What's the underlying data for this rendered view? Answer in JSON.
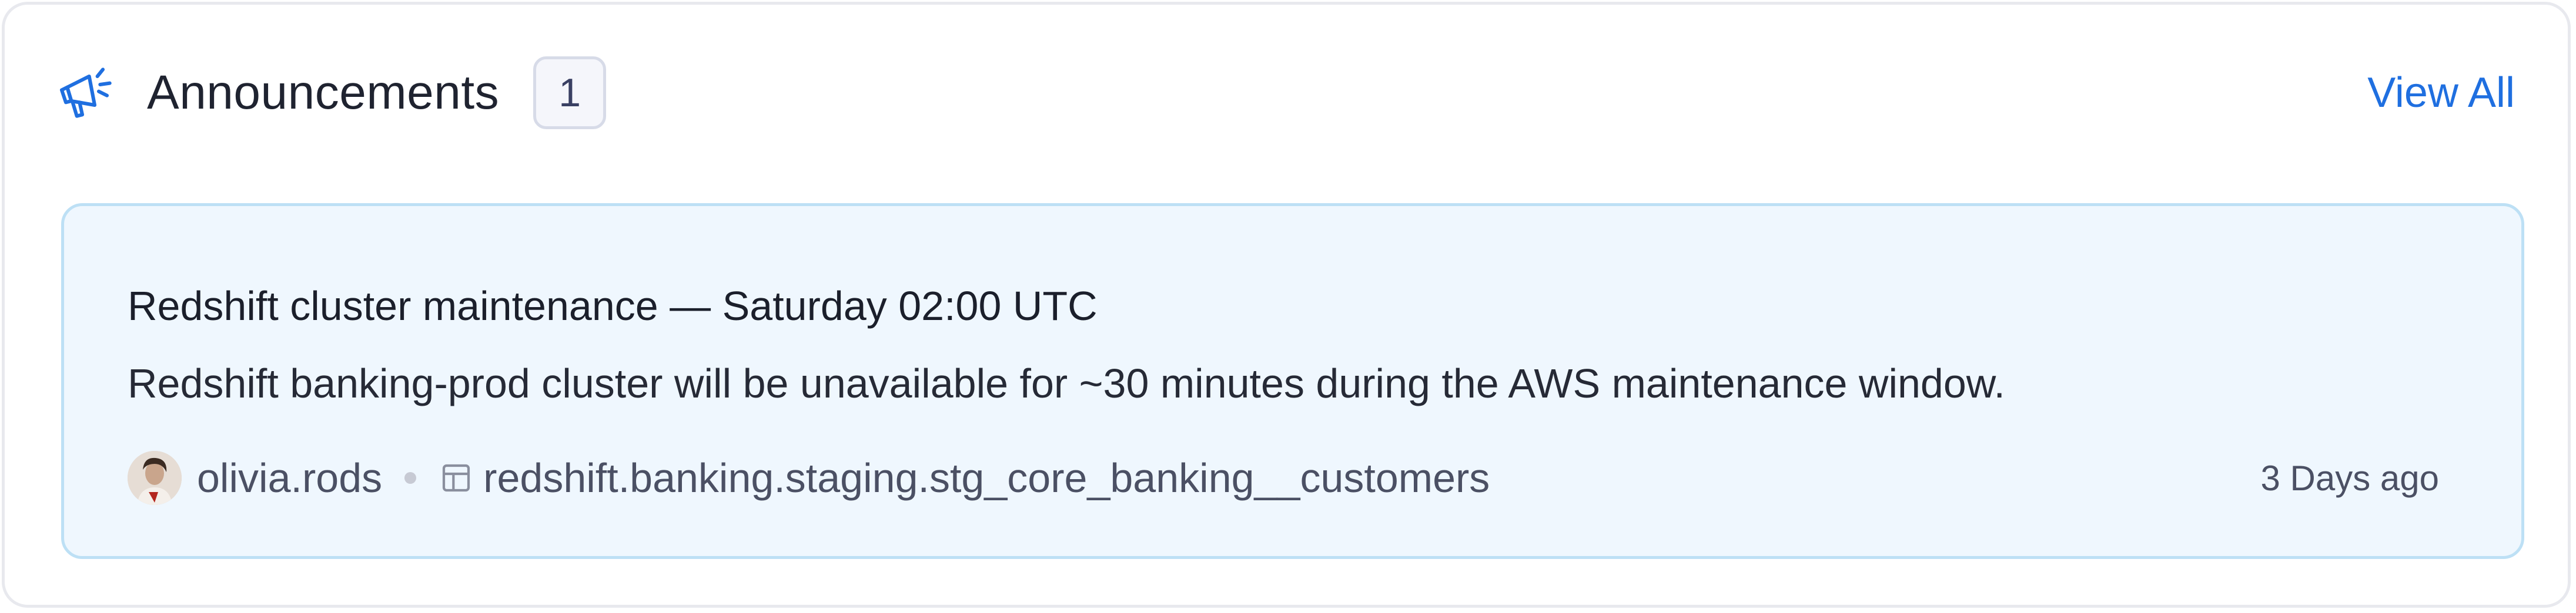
{
  "header": {
    "icon": "megaphone-icon",
    "title": "Announcements",
    "count": "1",
    "view_all": "View All",
    "accent_color": "#1f6fe0"
  },
  "announcement": {
    "title": "Redshift cluster maintenance — Saturday 02:00 UTC",
    "body": "Redshift banking-prod cluster will be unavailable for ~30 minutes during the AWS maintenance window.",
    "author": "olivia.rods",
    "asset_icon": "table-icon",
    "asset": "redshift.banking.staging.stg_core_banking__customers",
    "time": "3 Days ago",
    "card_bg": "#eff7fe",
    "card_border": "#bde0f5"
  }
}
